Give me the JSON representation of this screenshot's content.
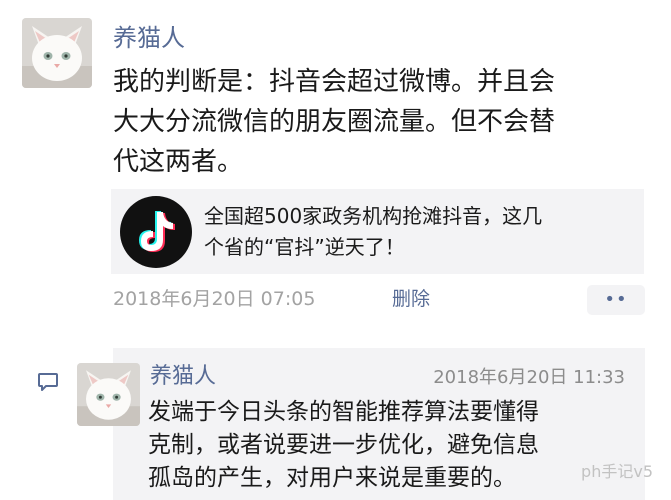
{
  "post": {
    "author": "养猫人",
    "avatar_icon": "white-cat-avatar",
    "text_lines": [
      "我的判断是：抖音会超过微博。并且会",
      "大大分流微信的朋友圈流量。但不会替",
      "代这两者。"
    ],
    "share": {
      "icon": "tiktok-icon",
      "title_lines": [
        "全国超500家政务机构抢滩抖音，这几",
        "个省的“官抖”逆天了！"
      ]
    },
    "timestamp": "2018年6月20日 07:05",
    "delete_label": "删除",
    "more_label": "••"
  },
  "comment": {
    "icon": "comment-bubble-icon",
    "avatar_icon": "white-cat-avatar",
    "author": "养猫人",
    "timestamp": "2018年6月20日 11:33",
    "text_lines": [
      "发端于今日头条的智能推荐算法要懂得",
      "克制，或者说要进一步优化，避免信息",
      "孤岛的产生，对用户来说是重要的。"
    ]
  },
  "watermark": "ph手记v5",
  "colors": {
    "name_link": "#576b95",
    "timestamp": "#a3a3a3",
    "panel_bg": "#f3f3f5"
  }
}
